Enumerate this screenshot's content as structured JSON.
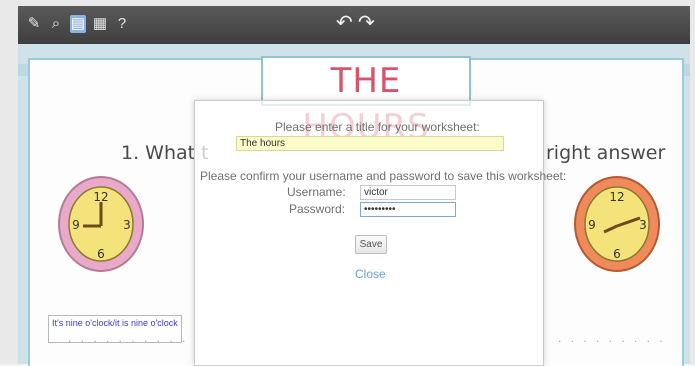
{
  "toolbar": {
    "icons": [
      "edit-icon",
      "preview-icon",
      "save-icon",
      "print-icon",
      "help-icon"
    ],
    "help_label": "?",
    "undo_icon": "undo-icon",
    "redo_icon": "redo-icon"
  },
  "worksheet": {
    "title": "THE HOURS",
    "question_left": "1. What t",
    "question_right": "right answer",
    "answer_text": "It's nine o'clock/it is nine o'clock",
    "accent_color": "#d9536a",
    "border_color": "#9ccbd8"
  },
  "dialog": {
    "title_prompt": "Please enter a title for your worksheet:",
    "title_value": "The hours",
    "confirm_prompt": "Please confirm your username and password to save this worksheet:",
    "username_label": "Username:",
    "username_value": "victor",
    "password_label": "Password:",
    "password_value": "•••••••••",
    "save_label": "Save",
    "close_label": "Close"
  }
}
